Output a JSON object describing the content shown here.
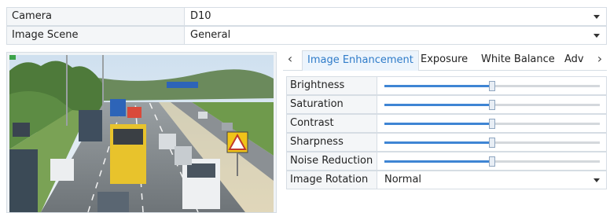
{
  "camera": {
    "label": "Camera",
    "value": "D10"
  },
  "image_scene": {
    "label": "Image Scene",
    "value": "General"
  },
  "preview": {
    "sign_icon": "warning-triangle-sign"
  },
  "tabs": {
    "prev_icon": "chevron-left",
    "next_icon": "chevron-right",
    "items": [
      "Image Enhancement",
      "Exposure",
      "White Balance",
      "Adv"
    ],
    "active": "Image Enhancement"
  },
  "settings": {
    "brightness": {
      "label": "Brightness",
      "level": 0.5
    },
    "saturation": {
      "label": "Saturation",
      "level": 0.5
    },
    "contrast": {
      "label": "Contrast",
      "level": 0.5
    },
    "sharpness": {
      "label": "Sharpness",
      "level": 0.5
    },
    "noise_reduction": {
      "label": "Noise Reduction",
      "level": 0.5
    },
    "image_rotation": {
      "label": "Image Rotation",
      "value": "Normal"
    }
  },
  "colors": {
    "accent": "#2f7cc9",
    "slider_fill": "#3f85d4",
    "label_bg": "#f4f6f8",
    "border": "#d6dde4"
  }
}
